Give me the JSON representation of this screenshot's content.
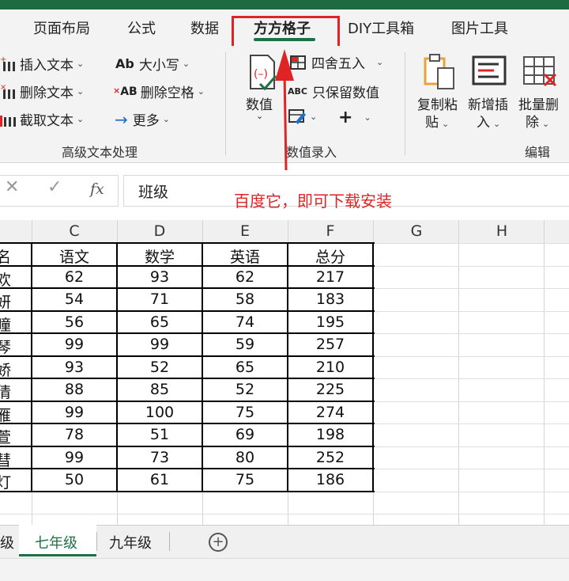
{
  "tabs": [
    "页面布局",
    "公式",
    "数据",
    "方方格子",
    "DIY工具箱",
    "图片工具"
  ],
  "ribbon": {
    "text_group": {
      "insert_text": "插入文本",
      "delete_text": "删除文本",
      "extract_text": "截取文本",
      "case": "大小写",
      "delete_spaces": "删除空格",
      "more": "更多",
      "label": "高级文本处理"
    },
    "entry_group": {
      "value": "数值",
      "round": "四舍五入",
      "keep_values": "只保留数值",
      "label": "数值录入"
    },
    "edit_group": {
      "copy_paste_1": "复制粘",
      "copy_paste_2": "贴",
      "insert_1": "新增插",
      "insert_2": "入",
      "batch_delete_1": "批量删",
      "batch_delete_2": "除",
      "label": "编辑"
    }
  },
  "formula_bar": {
    "cancel": "✕",
    "confirm": "✓",
    "fx": "fx",
    "value": "班级"
  },
  "annotation": "百度它，即可下载安装",
  "columns": [
    "C",
    "D",
    "E",
    "F",
    "G",
    "H"
  ],
  "header_row": {
    "name": "名",
    "c": "语文",
    "d": "数学",
    "e": "英语",
    "f": "总分"
  },
  "rows": [
    {
      "name": "欢",
      "c": "62",
      "d": "93",
      "e": "62",
      "f": "217"
    },
    {
      "name": "妍",
      "c": "54",
      "d": "71",
      "e": "58",
      "f": "183"
    },
    {
      "name": "瞳",
      "c": "56",
      "d": "65",
      "e": "74",
      "f": "195"
    },
    {
      "name": "琴",
      "c": "99",
      "d": "99",
      "e": "59",
      "f": "257"
    },
    {
      "name": "娇",
      "c": "93",
      "d": "52",
      "e": "65",
      "f": "210"
    },
    {
      "name": "倩",
      "c": "88",
      "d": "85",
      "e": "52",
      "f": "225"
    },
    {
      "name": "雁",
      "c": "99",
      "d": "100",
      "e": "75",
      "f": "274"
    },
    {
      "name": "萱",
      "c": "78",
      "d": "51",
      "e": "69",
      "f": "198"
    },
    {
      "name": "彗",
      "c": "99",
      "d": "73",
      "e": "80",
      "f": "252"
    },
    {
      "name": "灯",
      "c": "50",
      "d": "61",
      "e": "75",
      "f": "186"
    }
  ],
  "sheet_tabs": {
    "prev": "级",
    "active": "七年级",
    "next": "九年级",
    "add": "+"
  },
  "colors": {
    "accent": "#1e7145",
    "annotation": "#e02424"
  }
}
